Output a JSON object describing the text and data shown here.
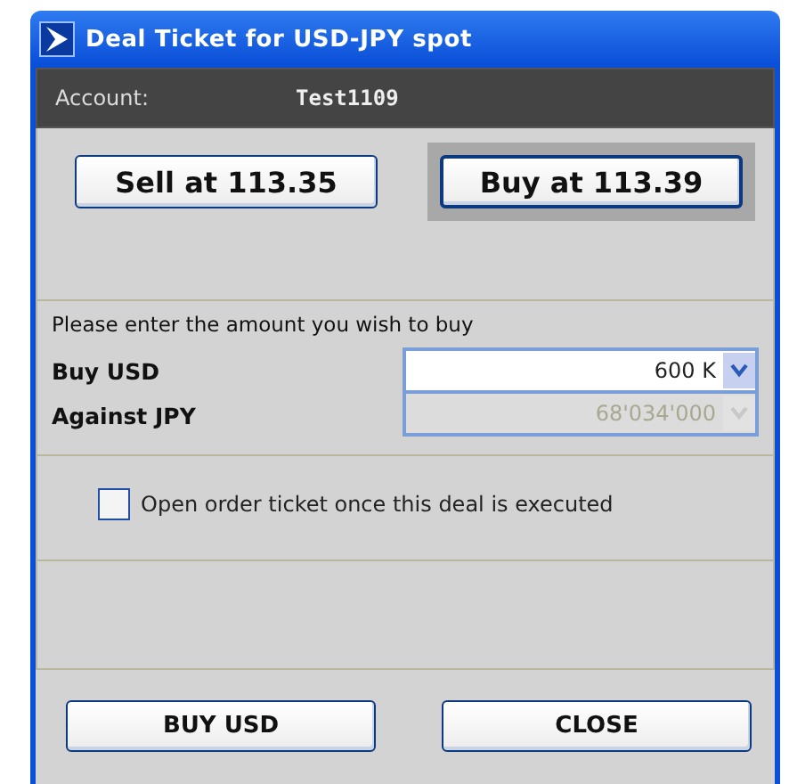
{
  "window": {
    "title": "Deal Ticket for USD-JPY spot"
  },
  "account": {
    "label": "Account:",
    "value": "Test1109"
  },
  "prices": [
    {
      "label": "Sell at 113.35",
      "selected": false
    },
    {
      "label": "Buy at 113.39",
      "selected": true
    }
  ],
  "amount": {
    "prompt": "Please enter the amount you wish to buy",
    "fields": [
      {
        "label": "Buy USD",
        "value": "600 K",
        "disabled": false
      },
      {
        "label": "Against JPY",
        "value": "68'034'000",
        "disabled": true
      }
    ]
  },
  "open_order_ticket": {
    "label": "Open order ticket once this deal is executed",
    "checked": false
  },
  "buttons": [
    "BUY USD",
    "CLOSE"
  ]
}
